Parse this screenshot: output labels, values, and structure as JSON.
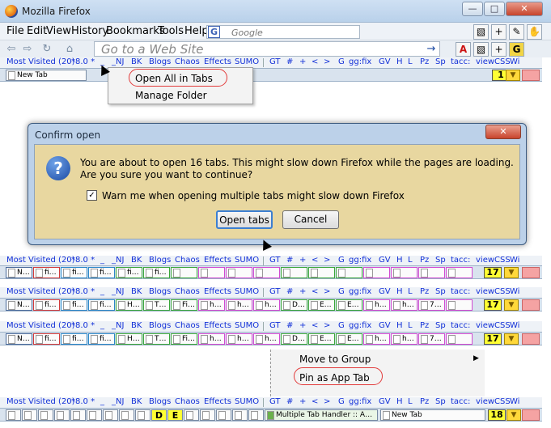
{
  "window": {
    "title": "Mozilla Firefox",
    "minimize": "—",
    "maximize": "□",
    "close": "✕"
  },
  "menubar": {
    "items": [
      {
        "label": "File"
      },
      {
        "label": "Edit"
      },
      {
        "label": "View"
      },
      {
        "label": "History"
      },
      {
        "label": "Bookmarks"
      },
      {
        "label": "Tools"
      },
      {
        "label": "Help"
      }
    ],
    "google_letter": "G",
    "google_placeholder": "Google"
  },
  "navbar": {
    "url_placeholder": "Go to a Web Site",
    "back": "⇦",
    "forward": "⇨",
    "reload": "↻",
    "home": "⌂",
    "go": "→",
    "tb_a": "A",
    "tb_plus": "+",
    "tb_g": "G",
    "tb_hand": "✋",
    "tb_pen": "✎",
    "tb_page": "▧"
  },
  "bookmarks": [
    "Most Visited (20)",
    "*8.0 *",
    "_",
    "_NJ",
    "BK",
    "Blogs",
    "Chaos",
    "Effects",
    "SUMO",
    "GT",
    "#",
    "+",
    "<",
    ">",
    "G",
    "gg:fix",
    "GV",
    "H",
    "L",
    "Pz",
    "Sp",
    "tacc:",
    "viewCSS",
    "Wi"
  ],
  "tabs_top": {
    "label": "New Tab",
    "count": "1",
    "arrow": "▼"
  },
  "folder_menu": {
    "open_all": "Open All in Tabs",
    "manage": "Manage Folder"
  },
  "dialog": {
    "title": "Confirm open",
    "close": "✕",
    "icon": "?",
    "message": "You are about to open 16 tabs.  This might slow down Firefox while the pages are loading.  Are you sure you want to continue?",
    "checkbox_label": "Warn me when opening multiple tabs might slow down Firefox",
    "checked_mark": "✓",
    "ok": "Open tabs",
    "cancel": "Cancel"
  },
  "tab_rows": [
    {
      "count": "17",
      "labels": [
        "N…",
        "fi…",
        "fi…",
        "fi…",
        "fi…",
        "fi…",
        "",
        "",
        "",
        "",
        "",
        "",
        "",
        "",
        "",
        "",
        ""
      ]
    },
    {
      "count": "17",
      "labels": [
        "N…",
        "fi…",
        "fi…",
        "fi…",
        "H…",
        "T…",
        "Fi…",
        "h…",
        "h…",
        "h…",
        "D…",
        "E…",
        "E…",
        "h…",
        "h…",
        "7…",
        ""
      ]
    },
    {
      "count": "17",
      "labels": [
        "N…",
        "fi…",
        "fi…",
        "fi…",
        "H…",
        "T…",
        "Fi…",
        "h…",
        "h…",
        "h…",
        "D…",
        "E…",
        "E…",
        "h…",
        "h…",
        "7…",
        ""
      ]
    }
  ],
  "context_menu": {
    "move": "Move to Group",
    "submenu_arrow": "▶",
    "pin": "Pin as App Tab"
  },
  "bottom_row": {
    "count": "18",
    "handler_tab": "Multiple Tab Handler :: A…",
    "new_tab": "New Tab",
    "letter_d": "D",
    "letter_e": "E"
  },
  "colors": {
    "link": "#1230d8",
    "counter": "#ffff33",
    "dialog_bg": "#e8d7a0",
    "highlight_oval": "#e23a3a"
  }
}
